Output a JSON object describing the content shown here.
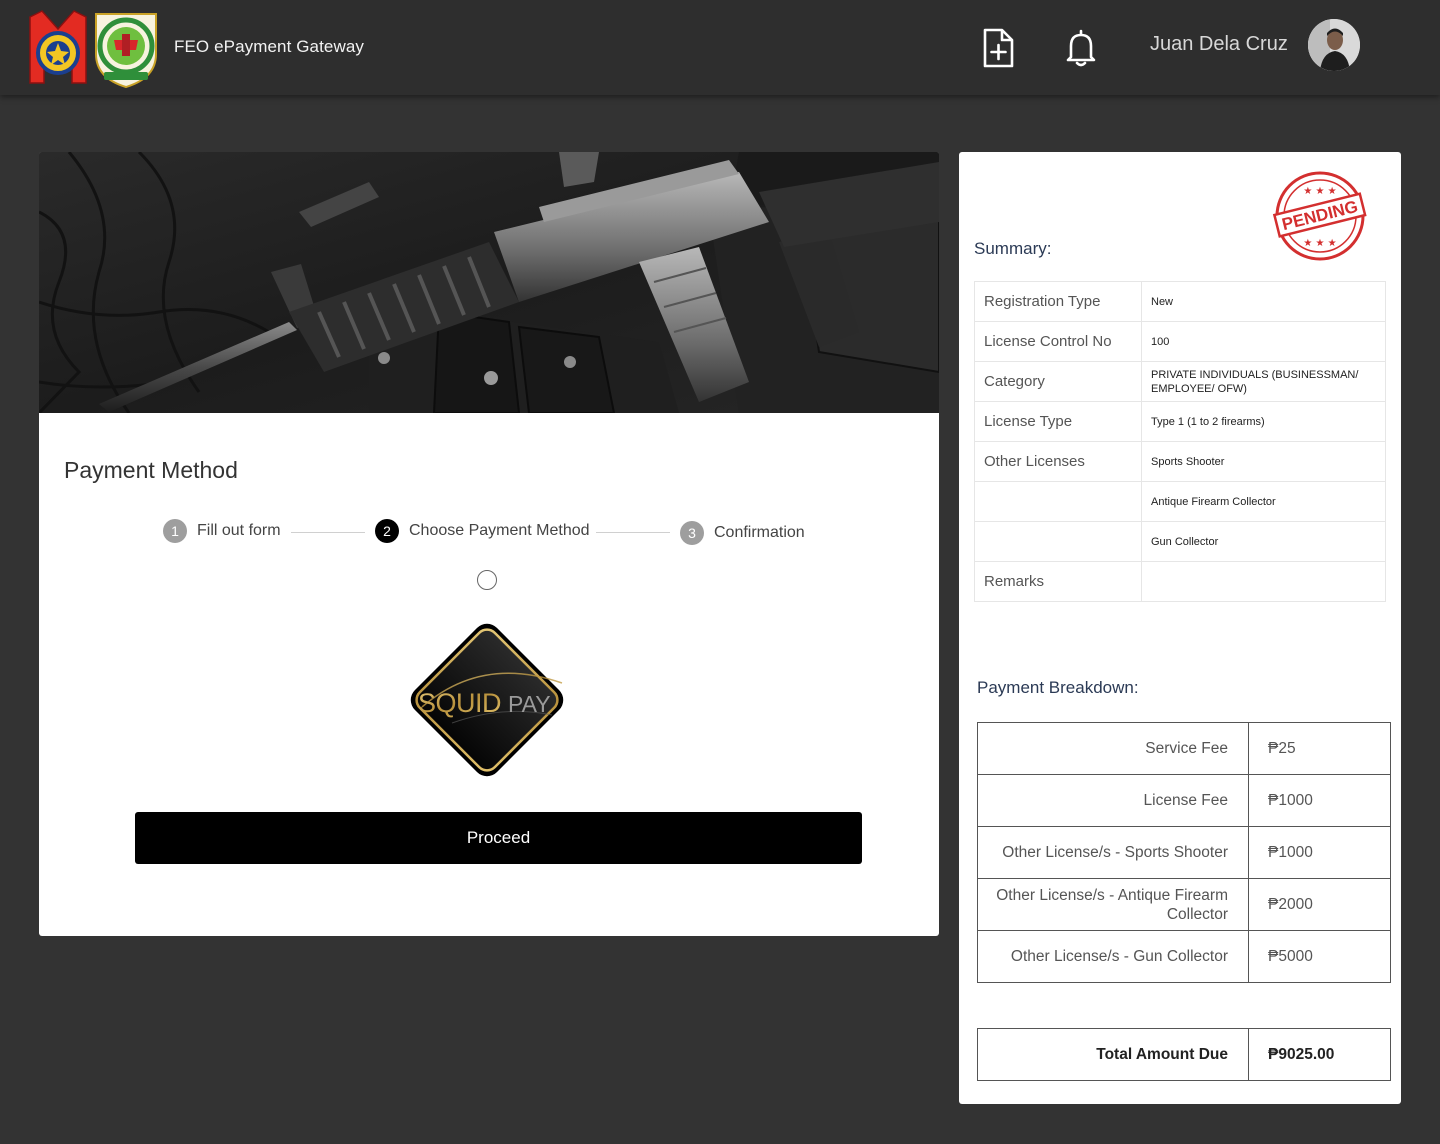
{
  "header": {
    "app_title": "FEO ePayment Gateway",
    "user_name": "Juan Dela Cruz",
    "icons": [
      "pnp-logo",
      "feo-logo",
      "new-document-icon",
      "bell-icon",
      "user-avatar"
    ]
  },
  "payment": {
    "section_title": "Payment Method",
    "steps": [
      {
        "number": "1",
        "label": "Fill out form",
        "state": "inactive"
      },
      {
        "number": "2",
        "label": "Choose Payment Method",
        "state": "active"
      },
      {
        "number": "3",
        "label": "Confirmation",
        "state": "inactive"
      }
    ],
    "option_selected": false,
    "option_logo_text": {
      "part1": "SQUID",
      "part2": "PAY"
    },
    "proceed_label": "Proceed"
  },
  "summary": {
    "title": "Summary:",
    "stamp_text": "PENDING",
    "rows": [
      {
        "label": "Registration Type",
        "value": "New"
      },
      {
        "label": "License Control No",
        "value": "100"
      },
      {
        "label": "Category",
        "value": "PRIVATE INDIVIDUALS (BUSINESSMAN/ EMPLOYEE/ OFW)"
      },
      {
        "label": "License Type",
        "value": "Type 1 (1 to 2 firearms)"
      },
      {
        "label": "Other Licenses",
        "value": "Sports Shooter"
      },
      {
        "label": "",
        "value": "Antique Firearm Collector"
      },
      {
        "label": "",
        "value": "Gun Collector"
      },
      {
        "label": "Remarks",
        "value": ""
      }
    ]
  },
  "breakdown": {
    "title": "Payment Breakdown:",
    "rows": [
      {
        "label": "Service Fee",
        "amount": "₱25"
      },
      {
        "label": "License Fee",
        "amount": "₱1000"
      },
      {
        "label": "Other License/s - Sports Shooter",
        "amount": "₱1000"
      },
      {
        "label": "Other License/s - Antique Firearm Collector",
        "amount": "₱2000"
      },
      {
        "label": "Other License/s - Gun Collector",
        "amount": "₱5000"
      }
    ],
    "total_label": "Total Amount Due",
    "total_amount": "₱9025.00"
  },
  "colors": {
    "background": "#333333",
    "topbar": "#2e2e2e",
    "active_step": "#000000",
    "inactive_step": "#9e9e9e",
    "stamp_red": "#d32f2f",
    "squid_gold": "#c9a24a"
  }
}
